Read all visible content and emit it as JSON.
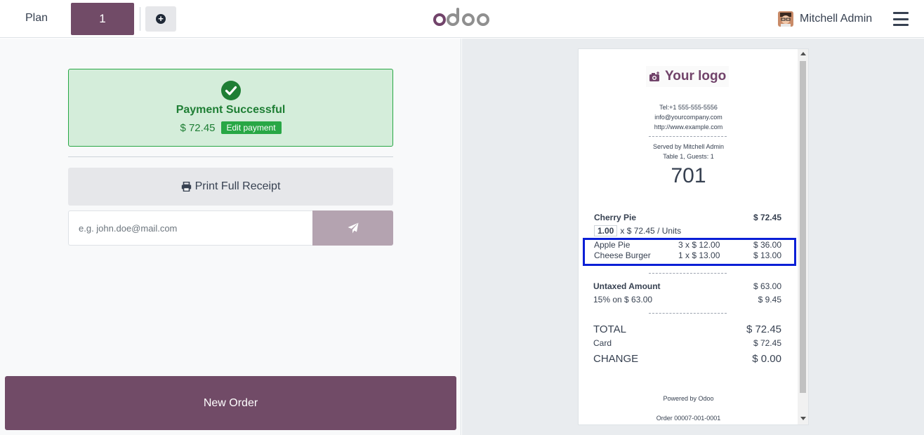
{
  "navbar": {
    "plan_label": "Plan",
    "table_number": "1",
    "add_icon": "plus-circle-icon",
    "logo_text": "odoo",
    "user_name": "Mitchell Admin",
    "menu_icon": "hamburger-icon"
  },
  "payment": {
    "status_icon": "check-circle-icon",
    "title": "Payment Successful",
    "amount": "$ 72.45",
    "edit_label": "Edit payment"
  },
  "actions": {
    "print_label": "Print Full Receipt",
    "email_placeholder": "e.g. john.doe@mail.com",
    "email_value": "",
    "send_icon": "paper-plane-icon",
    "new_order_label": "New Order"
  },
  "receipt": {
    "logo_text": "Your logo",
    "tel": "Tel:+1 555-555-5556",
    "email": "info@yourcompany.com",
    "website": "http://www.example.com",
    "served_by": "Served by Mitchell Admin",
    "table_guests": "Table 1, Guests: 1",
    "order_number": "701",
    "lines": [
      {
        "name": "Cherry Pie",
        "qty": "1.00",
        "unit": "x $ 72.45 / Units",
        "total": "$ 72.45"
      },
      {
        "name": "Apple Pie",
        "qty_price": "3 x $ 12.00",
        "total": "$ 36.00"
      },
      {
        "name": "Cheese Burger",
        "qty_price": "1 x $ 13.00",
        "total": "$ 13.00"
      }
    ],
    "untaxed_label": "Untaxed Amount",
    "untaxed_value": "$ 63.00",
    "tax_label": "15% on $ 63.00",
    "tax_value": "$ 9.45",
    "total_label": "TOTAL",
    "total_value": "$ 72.45",
    "card_label": "Card",
    "card_value": "$ 72.45",
    "change_label": "CHANGE",
    "change_value": "$ 0.00",
    "powered_by": "Powered by Odoo",
    "order_ref": "Order 00007-001-0001"
  },
  "colors": {
    "brand": "#714b67",
    "success": "#28a745",
    "success_bg": "#d4edda",
    "highlight": "#0a1fd6"
  }
}
